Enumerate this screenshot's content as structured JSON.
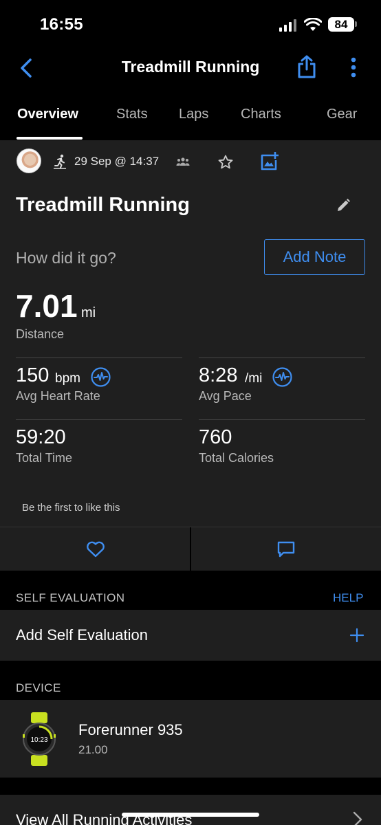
{
  "status_bar": {
    "time": "16:55",
    "battery": "84"
  },
  "header": {
    "title": "Treadmill Running"
  },
  "tabs": [
    {
      "label": "Overview",
      "active": true
    },
    {
      "label": "Stats",
      "active": false
    },
    {
      "label": "Laps",
      "active": false
    },
    {
      "label": "Charts",
      "active": false
    },
    {
      "label": "Gear",
      "active": false
    }
  ],
  "activity": {
    "date": "29 Sep @ 14:37",
    "title": "Treadmill Running",
    "prompt": "How did it go?",
    "add_note_label": "Add Note",
    "distance": {
      "value": "7.01",
      "unit": "mi",
      "label": "Distance"
    },
    "stats": {
      "heart_rate": {
        "value": "150",
        "unit": "bpm",
        "label": "Avg Heart Rate"
      },
      "pace": {
        "value": "8:28",
        "unit": "/mi",
        "label": "Avg Pace"
      },
      "time": {
        "value": "59:20",
        "label": "Total Time"
      },
      "calories": {
        "value": "760",
        "label": "Total Calories"
      }
    },
    "likes_text": "Be the first to like this"
  },
  "self_evaluation": {
    "section_label": "SELF EVALUATION",
    "help_label": "HELP",
    "add_label": "Add Self Evaluation"
  },
  "device": {
    "section_label": "DEVICE",
    "name": "Forerunner 935",
    "version": "21.00",
    "watch_face_time": "10:23"
  },
  "view_all_label": "View All Running Activities",
  "colors": {
    "accent": "#3f8ef0",
    "card": "#1f1f1f",
    "background": "#000000",
    "watch_accent": "#c8e020"
  },
  "icons": [
    "back-chevron-icon",
    "share-icon",
    "more-vertical-icon",
    "running-icon",
    "group-icon",
    "star-icon",
    "add-photo-icon",
    "edit-pencil-icon",
    "heart-rate-wave-icon",
    "heart-icon",
    "comment-icon",
    "plus-icon",
    "watch-icon",
    "chevron-right-icon"
  ]
}
